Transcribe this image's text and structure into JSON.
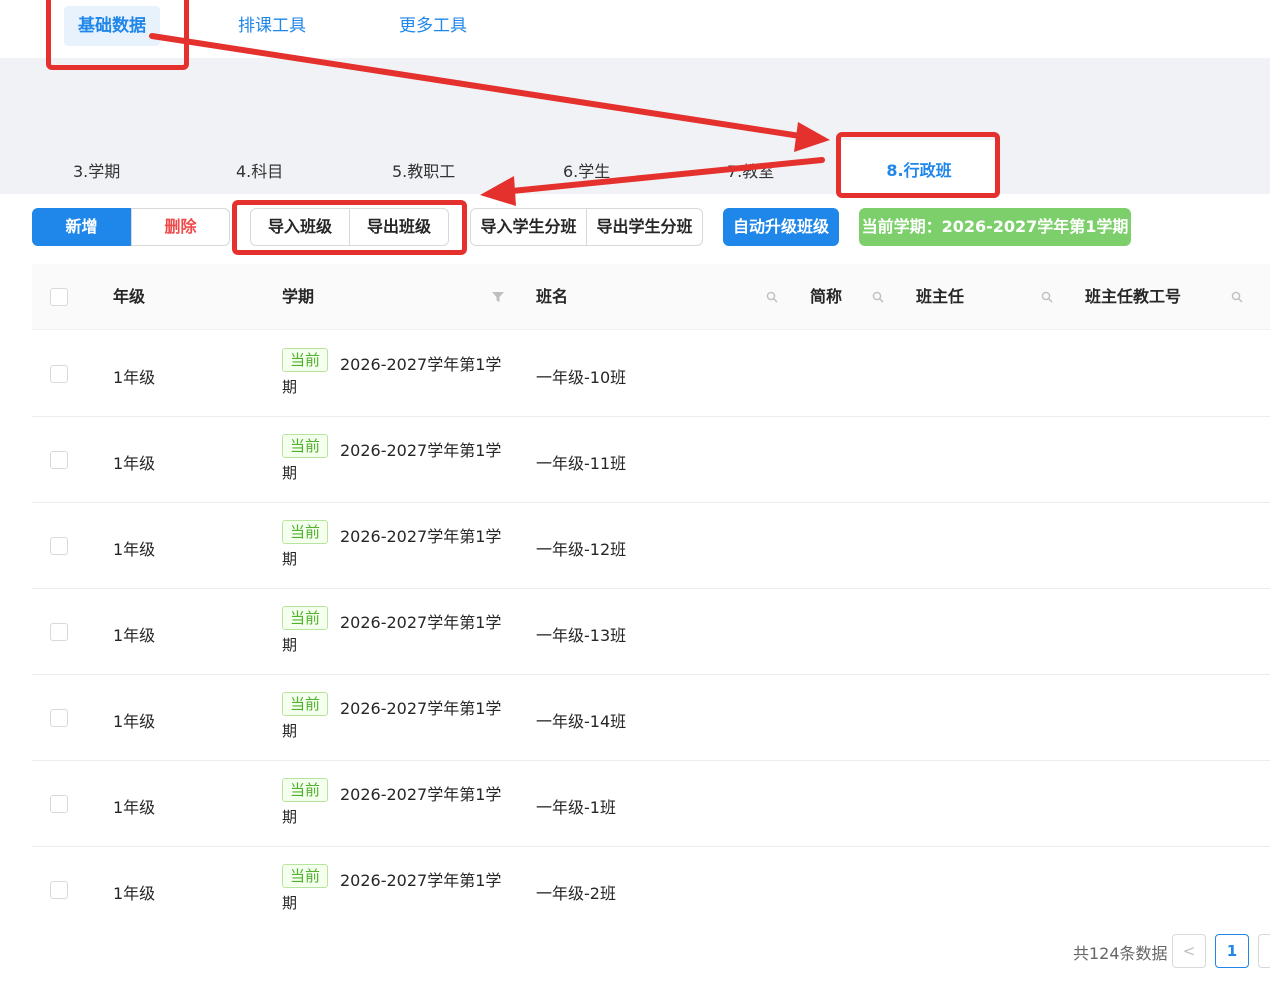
{
  "topnav": {
    "items": [
      "基础数据",
      "排课工具",
      "更多工具"
    ]
  },
  "tabs": [
    "3.学期",
    "4.科目",
    "5.教职工",
    "6.学生",
    "7.教室",
    "8.行政班"
  ],
  "toolbar": {
    "add": "新增",
    "delete": "删除",
    "import_class": "导入班级",
    "export_class": "导出班级",
    "import_student_class": "导入学生分班",
    "export_student_class": "导出学生分班",
    "auto_upgrade": "自动升级班级",
    "current_term": "当前学期：2026-2027学年第1学期"
  },
  "table": {
    "headers": {
      "grade": "年级",
      "term": "学期",
      "class_name": "班名",
      "short_name": "简称",
      "head_teacher": "班主任",
      "head_teacher_id": "班主任教工号"
    },
    "rows": [
      {
        "grade": "1年级",
        "tag": "当前",
        "term_line1": "2026-2027学年第1学",
        "term_line2": "期",
        "class_name": "一年级-10班"
      },
      {
        "grade": "1年级",
        "tag": "当前",
        "term_line1": "2026-2027学年第1学",
        "term_line2": "期",
        "class_name": "一年级-11班"
      },
      {
        "grade": "1年级",
        "tag": "当前",
        "term_line1": "2026-2027学年第1学",
        "term_line2": "期",
        "class_name": "一年级-12班"
      },
      {
        "grade": "1年级",
        "tag": "当前",
        "term_line1": "2026-2027学年第1学",
        "term_line2": "期",
        "class_name": "一年级-13班"
      },
      {
        "grade": "1年级",
        "tag": "当前",
        "term_line1": "2026-2027学年第1学",
        "term_line2": "期",
        "class_name": "一年级-14班"
      },
      {
        "grade": "1年级",
        "tag": "当前",
        "term_line1": "2026-2027学年第1学",
        "term_line2": "期",
        "class_name": "一年级-1班"
      },
      {
        "grade": "1年级",
        "tag": "当前",
        "term_line1": "2026-2027学年第1学",
        "term_line2": "期",
        "class_name": "一年级-2班"
      }
    ]
  },
  "pagination": {
    "total": "共124条数据",
    "prev": "<",
    "current_page": "1"
  },
  "colors": {
    "primary": "#1f86ea",
    "danger": "#ef4a4a",
    "success": "#7ccf6b",
    "annotation": "#e5312e"
  }
}
